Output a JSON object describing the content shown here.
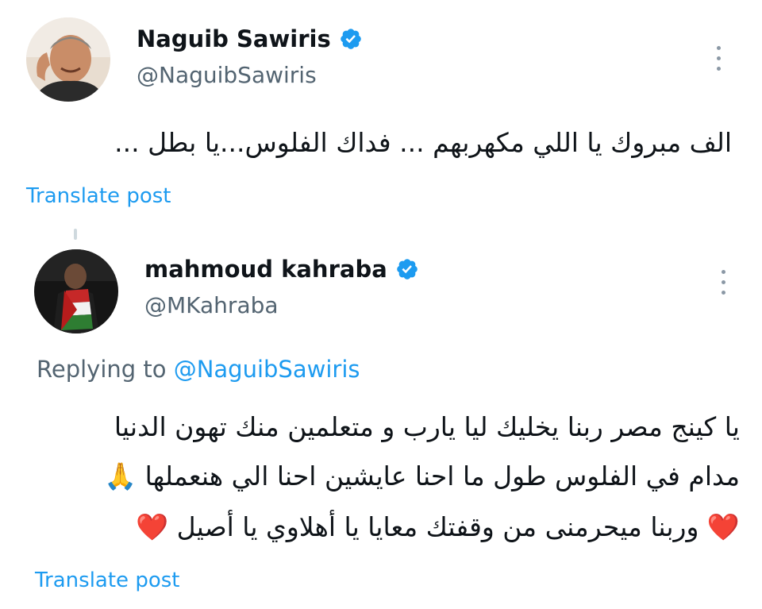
{
  "original": {
    "author_name": "Naguib Sawiris",
    "author_handle": "@NaguibSawiris",
    "text": "الف مبروك يا اللي مكهربهم ... فداك الفلوس...يا بطل ...",
    "translate_label": "Translate post"
  },
  "reply": {
    "author_name": "mahmoud kahraba",
    "author_handle": "@MKahraba",
    "replying_label": "Replying to",
    "replying_to": "@NaguibSawiris",
    "lines": [
      "يا كينج مصر ربنا يخليك ليا يارب و متعلمين منك تهون الدنيا",
      "مدام في الفلوس طول ما احنا عايشين احنا الي هنعملها 🙏",
      "❤️ وربنا ميحرمنى من وقفتك معايا يا أهلاوي  يا أصيل ❤️"
    ],
    "translate_label": "Translate post"
  },
  "icons": {
    "verified": "verified-badge-icon",
    "more": "more-vertical-icon",
    "heart": "red-heart-icon",
    "pray": "folded-hands-icon"
  },
  "colors": {
    "accent": "#1d9bf0",
    "text": "#0f1419",
    "secondary": "#536471",
    "heart": "#e0245e"
  }
}
